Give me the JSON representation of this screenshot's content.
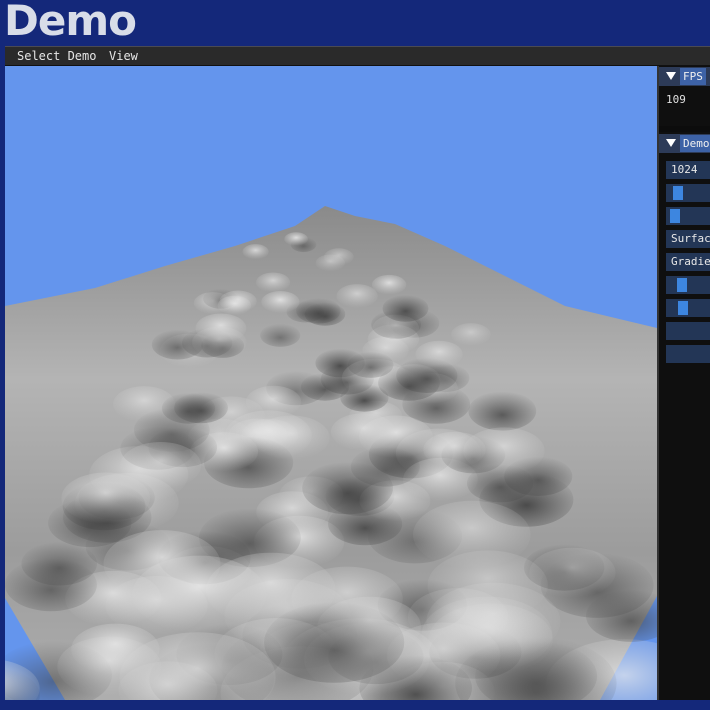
{
  "app": {
    "title": "Demo"
  },
  "menu": {
    "items": [
      "Select Demo",
      "View"
    ]
  },
  "fps_panel": {
    "tab_label": "FPS",
    "value": "109"
  },
  "demo_panel": {
    "tab_label": "Demo",
    "controls": [
      {
        "kind": "input",
        "text": "1024"
      },
      {
        "kind": "slider",
        "value": 0.15
      },
      {
        "kind": "slider",
        "value": 0.05
      },
      {
        "kind": "combo",
        "text": "Surface"
      },
      {
        "kind": "combo",
        "text": "Gradient"
      },
      {
        "kind": "slider",
        "value": 0.3
      },
      {
        "kind": "slider",
        "value": 0.33
      },
      {
        "kind": "button",
        "text": ""
      },
      {
        "kind": "button",
        "text": ""
      }
    ]
  },
  "colors": {
    "sky": "#6495ed",
    "title_bg": "#14287a",
    "widget_bg": "#233656",
    "slider_grab": "#3d86e0",
    "tab_active": "#3d62a6"
  }
}
